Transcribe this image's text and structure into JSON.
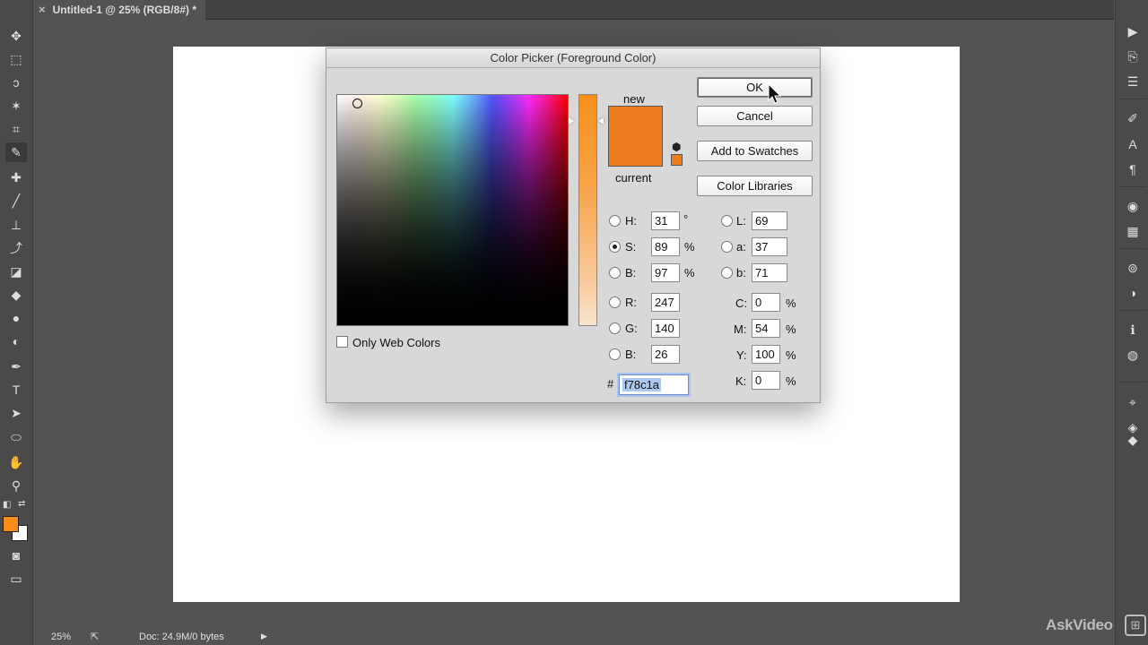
{
  "document": {
    "tab_title": "Untitled-1 @ 25% (RGB/8#) *",
    "close_symbol": "×"
  },
  "statusbar": {
    "zoom": "25%",
    "doc_info": "Doc: 24.9M/0 bytes"
  },
  "toolbar": {
    "tools": [
      "move-tool-icon",
      "marquee-tool-icon",
      "lasso-tool-icon",
      "magic-wand-icon",
      "crop-tool-icon",
      "eyedropper-icon",
      "healing-brush-icon",
      "brush-tool-icon",
      "clone-stamp-icon",
      "history-brush-icon",
      "eraser-icon",
      "paint-bucket-icon",
      "blur-tool-icon",
      "dodge-tool-icon",
      "pen-tool-icon",
      "type-tool-icon",
      "path-selection-icon",
      "ellipse-tool-icon",
      "hand-tool-icon",
      "zoom-tool-icon"
    ],
    "foreground_color": "#f78c1a",
    "background_color": "#ffffff"
  },
  "dialog": {
    "title": "Color Picker (Foreground Color)",
    "new_label": "new",
    "current_label": "current",
    "new_color": "#ed7d1f",
    "current_color": "#ed7d1f",
    "buttons": {
      "ok": "OK",
      "cancel": "Cancel",
      "add_swatches": "Add to Swatches",
      "color_libraries": "Color Libraries"
    },
    "only_web_colors": "Only Web Colors",
    "hsb": [
      {
        "label": "H:",
        "value": "31",
        "unit": "°",
        "selected": false
      },
      {
        "label": "S:",
        "value": "89",
        "unit": "%",
        "selected": true
      },
      {
        "label": "B:",
        "value": "97",
        "unit": "%",
        "selected": false
      }
    ],
    "rgb": [
      {
        "label": "R:",
        "value": "247"
      },
      {
        "label": "G:",
        "value": "140"
      },
      {
        "label": "B:",
        "value": "26"
      }
    ],
    "lab": [
      {
        "label": "L:",
        "value": "69"
      },
      {
        "label": "a:",
        "value": "37"
      },
      {
        "label": "b:",
        "value": "71"
      }
    ],
    "cmyk": [
      {
        "label": "C:",
        "value": "0",
        "unit": "%"
      },
      {
        "label": "M:",
        "value": "54",
        "unit": "%"
      },
      {
        "label": "Y:",
        "value": "100",
        "unit": "%"
      },
      {
        "label": "K:",
        "value": "0",
        "unit": "%"
      }
    ],
    "hex_label": "#",
    "hex_value": "f78c1a"
  },
  "watermark": {
    "text": "AskVideo",
    "logo": "⊞"
  }
}
